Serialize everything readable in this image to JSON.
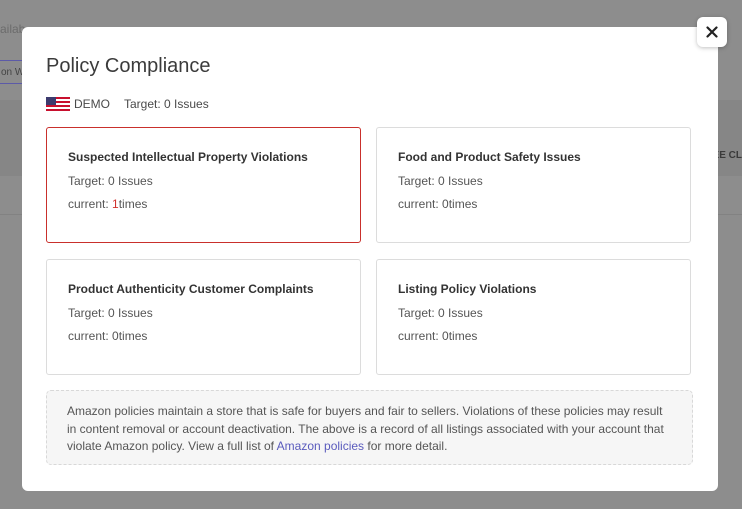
{
  "background": {
    "text_fragment": "ailab",
    "button_fragment": "on W",
    "right_fragment": "EE CL"
  },
  "modal": {
    "title": "Policy Compliance",
    "store_name": "DEMO",
    "store_flag": "us-flag-icon",
    "target_summary": "Target: 0 Issues",
    "close_icon": "close-icon"
  },
  "cards": [
    {
      "title": "Suspected Intellectual Property Violations",
      "target": "Target: 0 Issues",
      "current_prefix": "current: ",
      "current_count": "1",
      "current_suffix": "times",
      "highlighted": true
    },
    {
      "title": "Food and Product Safety Issues",
      "target": "Target: 0 Issues",
      "current_prefix": "current: ",
      "current_count": "0",
      "current_suffix": "times",
      "highlighted": false
    },
    {
      "title": "Product Authenticity Customer Complaints",
      "target": "Target: 0 Issues",
      "current_prefix": "current: ",
      "current_count": "0",
      "current_suffix": "times",
      "highlighted": false
    },
    {
      "title": "Listing Policy Violations",
      "target": "Target: 0 Issues",
      "current_prefix": "current: ",
      "current_count": "0",
      "current_suffix": "times",
      "highlighted": false
    }
  ],
  "note": {
    "text_before": "Amazon policies maintain a store that is safe for buyers and fair to sellers. Violations of these policies may result in content removal or account deactivation. The above is a record of all listings associated with your account that violate Amazon policy. View a full list of ",
    "link_text": "Amazon policies",
    "text_after": " for more detail."
  },
  "colors": {
    "highlight_border": "#c9302c",
    "alert_text": "#d0312d",
    "link": "#5a5bbd"
  }
}
